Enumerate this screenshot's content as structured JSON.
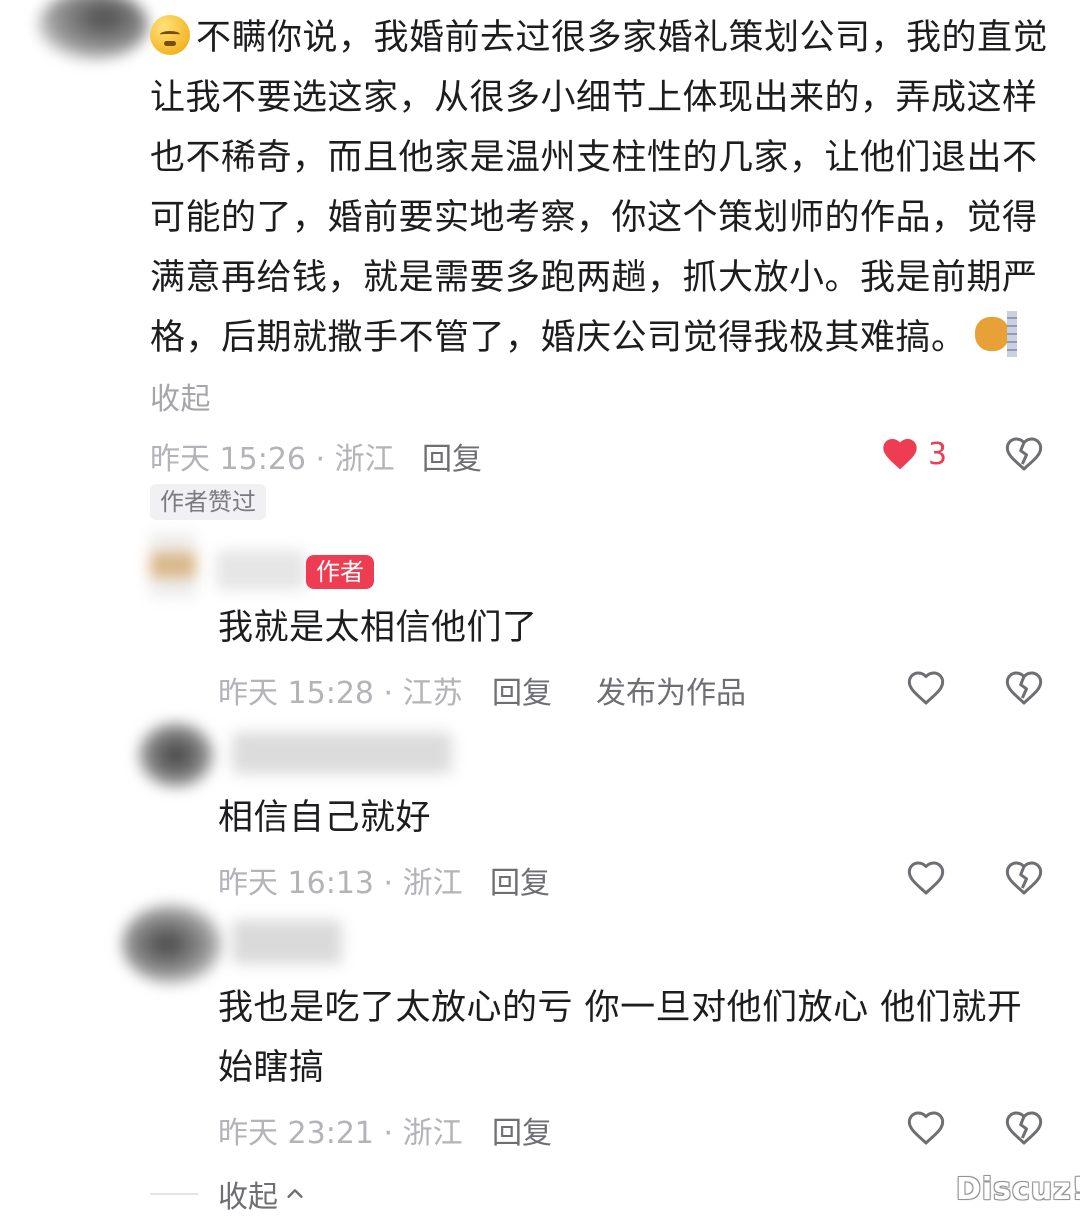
{
  "comment": {
    "text": "不瞒你说，我婚前去过很多家婚礼策划公司，我的直觉让我不要选这家，从很多小细节上体现出来的，弄成这样也不稀奇，而且他家是温州支柱性的几家，让他们退出不可能的了，婚前要实地考察，你这个策划师的作品，觉得满意再给钱，就是需要多跑两趟，抓大放小。我是前期严格，后期就撒手不管了，婚庆公司觉得我极其难搞。",
    "collapse_label": "收起",
    "timestamp": "昨天 15:26 · 浙江",
    "reply_label": "回复",
    "like_count": "3",
    "author_liked_tag": "作者赞过",
    "like_color": "#ee3c52"
  },
  "replies": [
    {
      "author_badge": "作者",
      "text": "我就是太相信他们了",
      "timestamp": "昨天 15:28 · 江苏",
      "reply_label": "回复",
      "publish_label": "发布为作品"
    },
    {
      "text": "相信自己就好",
      "timestamp": "昨天 16:13 · 浙江",
      "reply_label": "回复"
    },
    {
      "text": "我也是吃了太放心的亏 你一旦对他们放心 他们就开始瞎搞",
      "timestamp": "昨天 23:21 · 浙江",
      "reply_label": "回复"
    }
  ],
  "footer": {
    "collapse_label": "收起",
    "watermark": "Discuz!"
  }
}
